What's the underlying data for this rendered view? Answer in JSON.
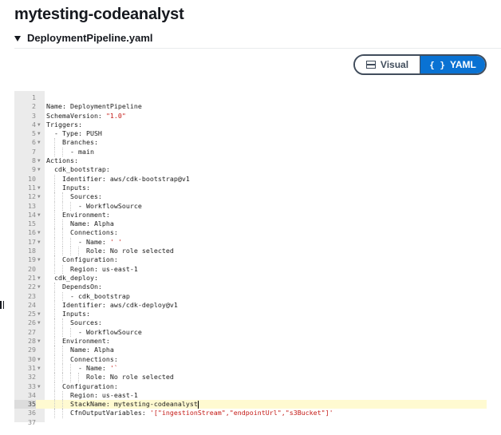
{
  "page": {
    "title": "mytesting-codeanalyst"
  },
  "file": {
    "name": "DeploymentPipeline.yaml"
  },
  "view_toggle": {
    "visual_label": "Visual",
    "yaml_label": "YAML",
    "selected": "YAML"
  },
  "editor": {
    "active_line": 35,
    "lines": [
      {
        "n": "1",
        "fold": false,
        "text": ""
      },
      {
        "n": "2",
        "fold": false,
        "text": "Name: DeploymentPipeline"
      },
      {
        "n": "3",
        "fold": false,
        "text": "SchemaVersion: \"1.0\""
      },
      {
        "n": "4",
        "fold": true,
        "text": "Triggers:"
      },
      {
        "n": "5",
        "fold": true,
        "text": "  - Type: PUSH"
      },
      {
        "n": "6",
        "fold": true,
        "text": "    Branches:"
      },
      {
        "n": "7",
        "fold": false,
        "text": "      - main"
      },
      {
        "n": "8",
        "fold": true,
        "text": "Actions:"
      },
      {
        "n": "9",
        "fold": true,
        "text": "  cdk_bootstrap:"
      },
      {
        "n": "10",
        "fold": false,
        "text": "    Identifier: aws/cdk-bootstrap@v1"
      },
      {
        "n": "11",
        "fold": true,
        "text": "    Inputs:"
      },
      {
        "n": "12",
        "fold": true,
        "text": "      Sources:"
      },
      {
        "n": "13",
        "fold": false,
        "text": "        - WorkflowSource"
      },
      {
        "n": "14",
        "fold": true,
        "text": "    Environment:"
      },
      {
        "n": "15",
        "fold": false,
        "text": "      Name: Alpha"
      },
      {
        "n": "16",
        "fold": true,
        "text": "      Connections:"
      },
      {
        "n": "17",
        "fold": true,
        "text": "        - Name: ' '"
      },
      {
        "n": "18",
        "fold": false,
        "text": "          Role: No role selected"
      },
      {
        "n": "19",
        "fold": true,
        "text": "    Configuration:"
      },
      {
        "n": "20",
        "fold": false,
        "text": "      Region: us-east-1"
      },
      {
        "n": "21",
        "fold": true,
        "text": "  cdk_deploy:"
      },
      {
        "n": "22",
        "fold": true,
        "text": "    DependsOn:"
      },
      {
        "n": "23",
        "fold": false,
        "text": "      - cdk_bootstrap"
      },
      {
        "n": "24",
        "fold": false,
        "text": "    Identifier: aws/cdk-deploy@v1"
      },
      {
        "n": "25",
        "fold": true,
        "text": "    Inputs:"
      },
      {
        "n": "26",
        "fold": true,
        "text": "      Sources:"
      },
      {
        "n": "27",
        "fold": false,
        "text": "        - WorkflowSource"
      },
      {
        "n": "28",
        "fold": true,
        "text": "    Environment:"
      },
      {
        "n": "29",
        "fold": false,
        "text": "      Name: Alpha"
      },
      {
        "n": "30",
        "fold": true,
        "text": "      Connections:"
      },
      {
        "n": "31",
        "fold": true,
        "text": "        - Name: '`"
      },
      {
        "n": "32",
        "fold": false,
        "text": "          Role: No role selected"
      },
      {
        "n": "33",
        "fold": true,
        "text": "    Configuration:"
      },
      {
        "n": "34",
        "fold": false,
        "text": "      Region: us-east-1"
      },
      {
        "n": "35",
        "fold": false,
        "text": "      StackName: mytesting-codeanalyst"
      },
      {
        "n": "36",
        "fold": false,
        "text": "      CfnOutputVariables: '[\"ingestionStream\",\"endpointUrl\",\"s3Bucket\"]'"
      },
      {
        "n": "37",
        "fold": false,
        "text": ""
      }
    ]
  }
}
